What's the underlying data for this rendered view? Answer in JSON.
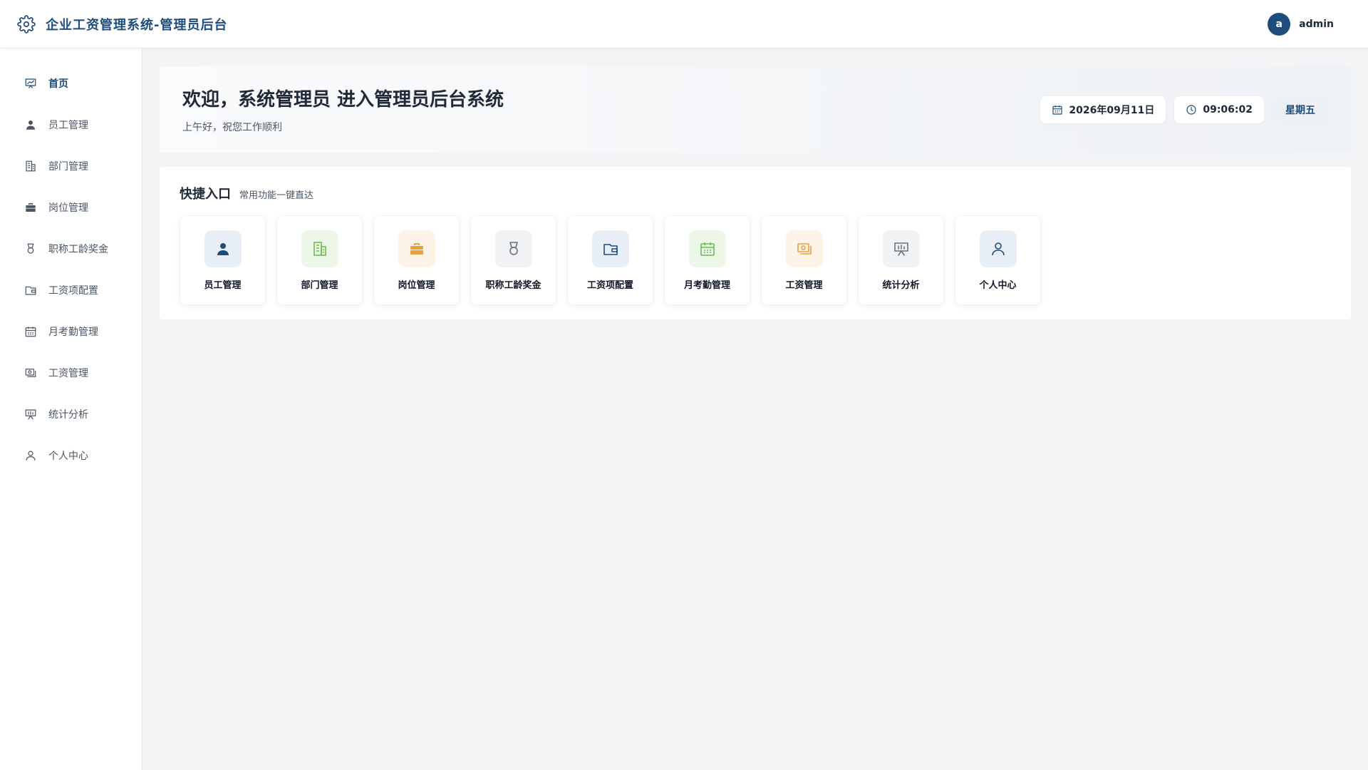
{
  "header": {
    "title": "企业工资管理系统-管理员后台",
    "avatar_letter": "a",
    "username": "admin"
  },
  "sidebar": {
    "items": [
      {
        "label": "首页",
        "icon": "chart-board-icon"
      },
      {
        "label": "员工管理",
        "icon": "person-icon"
      },
      {
        "label": "部门管理",
        "icon": "building-icon"
      },
      {
        "label": "岗位管理",
        "icon": "briefcase-icon"
      },
      {
        "label": "职称工龄奖金",
        "icon": "medal-icon"
      },
      {
        "label": "工资项配置",
        "icon": "wallet-icon"
      },
      {
        "label": "月考勤管理",
        "icon": "calendar-icon"
      },
      {
        "label": "工资管理",
        "icon": "money-icon"
      },
      {
        "label": "统计分析",
        "icon": "presentation-icon"
      },
      {
        "label": "个人中心",
        "icon": "user-outline-icon"
      }
    ]
  },
  "welcome": {
    "title": "欢迎，系统管理员 进入管理员后台系统",
    "subtitle": "上午好，祝您工作顺利",
    "date": "2026年09月11日",
    "time": "09:06:02",
    "weekday": "星期五"
  },
  "quick": {
    "title": "快捷入口",
    "subtitle": "常用功能一键直达",
    "cards": [
      {
        "label": "员工管理",
        "icon": "person-icon",
        "color": "#1e4d7b",
        "bg": "#e8eef5"
      },
      {
        "label": "部门管理",
        "icon": "building-icon",
        "color": "#6abf4b",
        "bg": "#edf7e9"
      },
      {
        "label": "岗位管理",
        "icon": "briefcase-icon",
        "color": "#e6a23c",
        "bg": "#fdf3e6"
      },
      {
        "label": "职称工龄奖金",
        "icon": "medal-icon",
        "color": "#6b7280",
        "bg": "#f1f2f4"
      },
      {
        "label": "工资项配置",
        "icon": "wallet-icon",
        "color": "#1e4d7b",
        "bg": "#e8eef5"
      },
      {
        "label": "月考勤管理",
        "icon": "calendar-icon",
        "color": "#6abf4b",
        "bg": "#edf7e9"
      },
      {
        "label": "工资管理",
        "icon": "money-icon",
        "color": "#e6a23c",
        "bg": "#fdf3e6"
      },
      {
        "label": "统计分析",
        "icon": "presentation-icon",
        "color": "#6b7280",
        "bg": "#f1f2f4"
      },
      {
        "label": "个人中心",
        "icon": "user-outline-icon",
        "color": "#1e4d7b",
        "bg": "#e8eef5"
      }
    ]
  },
  "colors": {
    "primary": "#1e4d7b",
    "background": "#f3f4f6"
  }
}
